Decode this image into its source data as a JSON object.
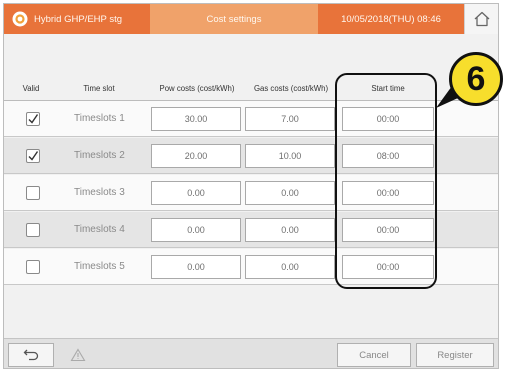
{
  "header": {
    "app_title": "Hybrid GHP/EHP stg",
    "screen_title": "Cost settings",
    "datetime": "10/05/2018(THU) 08:46",
    "home_icon": "home-icon",
    "logo_icon": "sun-logo-icon",
    "accent": "#e8733a"
  },
  "table": {
    "columns": {
      "valid": "Valid",
      "time_slot": "Time slot",
      "pow_costs": "Pow costs (cost/kWh)",
      "gas_costs": "Gas costs (cost/kWh)",
      "start_time": "Start time"
    },
    "rows": [
      {
        "valid": true,
        "slot": "Timeslots 1",
        "pow": "30.00",
        "gas": "7.00",
        "start": "00:00"
      },
      {
        "valid": true,
        "slot": "Timeslots 2",
        "pow": "20.00",
        "gas": "10.00",
        "start": "08:00"
      },
      {
        "valid": false,
        "slot": "Timeslots 3",
        "pow": "0.00",
        "gas": "0.00",
        "start": "00:00"
      },
      {
        "valid": false,
        "slot": "Timeslots 4",
        "pow": "0.00",
        "gas": "0.00",
        "start": "00:00"
      },
      {
        "valid": false,
        "slot": "Timeslots 5",
        "pow": "0.00",
        "gas": "0.00",
        "start": "00:00"
      }
    ]
  },
  "callout": {
    "number": "6",
    "color": "#f7de2c"
  },
  "footer": {
    "back_icon": "back-arrow-icon",
    "warning_icon": "warning-icon",
    "cancel_label": "Cancel",
    "register_label": "Register"
  }
}
